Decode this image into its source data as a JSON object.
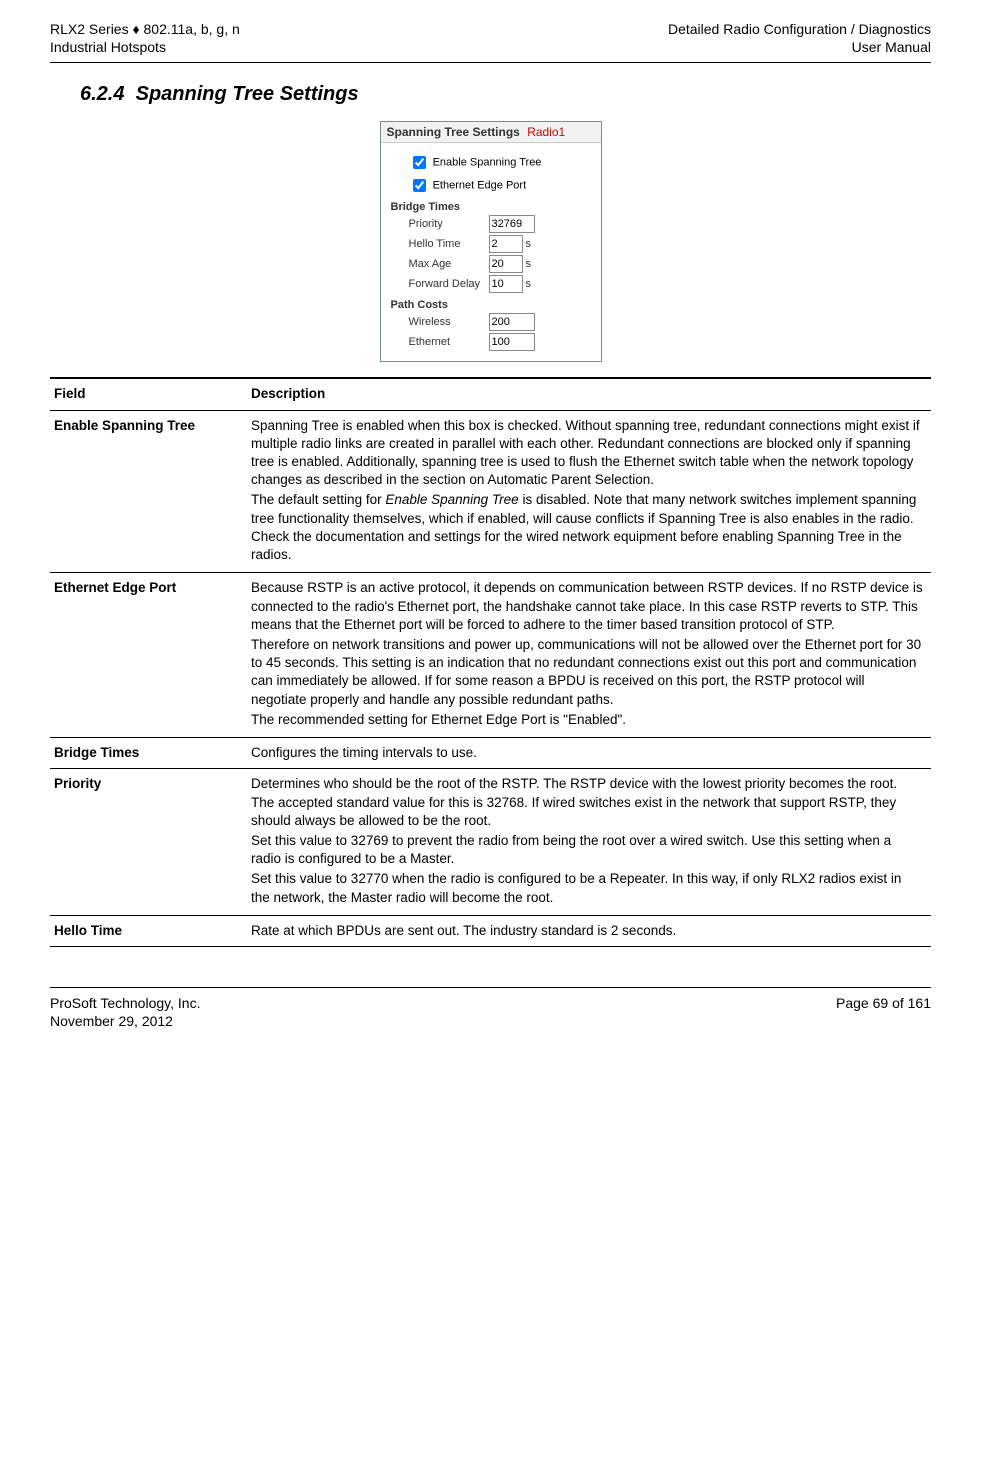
{
  "header": {
    "left_line1": "RLX2 Series ♦ 802.11a, b, g, n",
    "left_line2": "Industrial Hotspots",
    "right_line1": "Detailed Radio Configuration / Diagnostics",
    "right_line2": "User Manual"
  },
  "section": {
    "number": "6.2.4",
    "title": "Spanning Tree Settings"
  },
  "screenshot": {
    "title": "Spanning Tree Settings",
    "radio_tag": "Radio1",
    "enable_spanning_tree": "Enable Spanning Tree",
    "ethernet_edge_port": "Ethernet Edge Port",
    "bridge_times_label": "Bridge Times",
    "priority_label": "Priority",
    "priority_value": "32769",
    "hello_label": "Hello Time",
    "hello_value": "2",
    "maxage_label": "Max Age",
    "maxage_value": "20",
    "fwd_label": "Forward Delay",
    "fwd_value": "10",
    "unit_s": "s",
    "path_costs_label": "Path Costs",
    "wireless_label": "Wireless",
    "wireless_value": "200",
    "ethernet_label": "Ethernet",
    "ethernet_value": "100"
  },
  "table": {
    "col_field": "Field",
    "col_desc": "Description",
    "rows": [
      {
        "field": "Enable Spanning Tree",
        "desc_p1": "Spanning Tree is enabled when this box is checked. Without spanning tree, redundant connections might exist if multiple radio links are created in parallel with each other. Redundant connections are blocked only if spanning tree is enabled. Additionally, spanning tree is used to flush the Ethernet switch table when the network topology changes as described in the section on Automatic Parent Selection.",
        "desc_p2a": "The default setting for ",
        "desc_p2em": "Enable Spanning Tree",
        "desc_p2b": " is disabled. Note that many network switches implement spanning tree functionality themselves, which if enabled, will cause conflicts if Spanning Tree is also enables in the radio. Check the documentation and settings for the wired network equipment before enabling Spanning Tree in the radios."
      },
      {
        "field": "Ethernet Edge Port",
        "desc_p1": "Because RSTP is an active protocol, it depends on communication between RSTP devices. If no RSTP device is connected to the radio's Ethernet port, the handshake cannot take place. In this case RSTP reverts to STP. This means that the Ethernet port will be forced to adhere to the timer based transition protocol of STP.",
        "desc_p2": "Therefore on network transitions and power up, communications will not be allowed over the Ethernet port for 30 to 45 seconds. This setting is an indication that no redundant connections exist out this port and communication can immediately be allowed. If for some reason a BPDU is received on this port, the RSTP protocol will negotiate properly and handle any possible redundant paths.",
        "desc_p3": "The recommended setting for Ethernet Edge Port is \"Enabled\"."
      },
      {
        "field": "Bridge Times",
        "desc": "Configures the timing intervals to use."
      },
      {
        "field": "Priority",
        "desc_p1": "Determines who should be the root of the RSTP. The RSTP device with the lowest priority becomes the root. The accepted standard value for this is 32768. If wired switches exist in the network that support RSTP, they should always be allowed to be the root.",
        "desc_p2": "Set this value to 32769 to prevent the radio from being the root over a wired switch. Use this setting when a radio is configured to be a Master.",
        "desc_p3": "Set this value to 32770 when the radio is configured to be a Repeater. In this way, if only RLX2 radios exist in the network, the Master radio will become the root."
      },
      {
        "field": "Hello Time",
        "desc": "Rate at which BPDUs are sent out. The industry standard is 2 seconds."
      }
    ]
  },
  "footer": {
    "left_line1": "ProSoft Technology, Inc.",
    "left_line2": "November 29, 2012",
    "right": "Page 69 of 161"
  }
}
